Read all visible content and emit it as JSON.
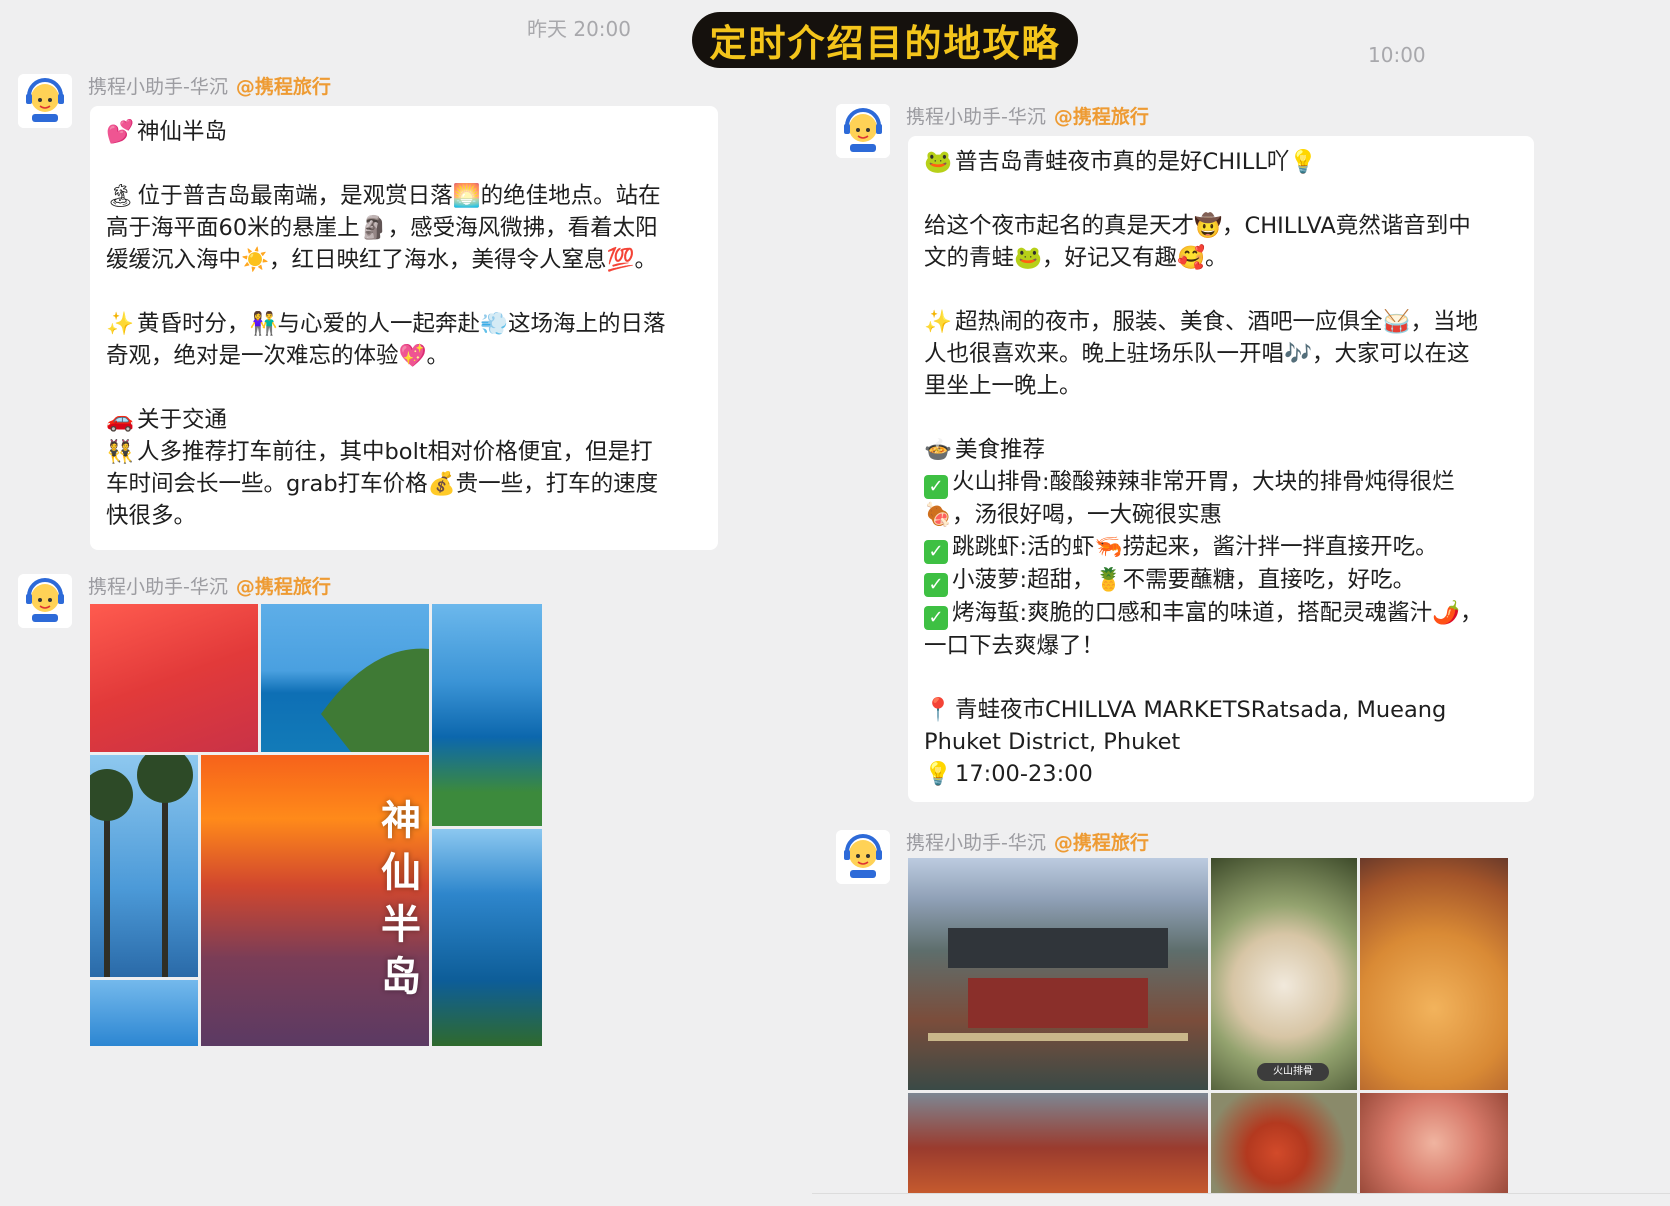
{
  "timestamps": {
    "left": "昨天 20:00",
    "right": "10:00"
  },
  "banner": {
    "text": "定时介绍目的地攻略"
  },
  "sender": {
    "name": "携程小助手-华沉",
    "tag": "@携程旅行"
  },
  "left_message": {
    "lines": [
      {
        "emoji": "💕",
        "text": "神仙半岛"
      },
      {
        "gap": true
      },
      {
        "emoji": "🏝",
        "text": "位于普吉岛最南端，是观赏日落🌅的绝佳地点。站在"
      },
      {
        "text": "高于海平面60米的悬崖上🗿，感受海风微拂，看着太阳"
      },
      {
        "text": "缓缓沉入海中☀️，红日映红了海水，美得令人窒息💯。"
      },
      {
        "gap": true
      },
      {
        "emoji": "✨",
        "text": "黄昏时分，👫与心爱的人一起奔赴💨这场海上的日落"
      },
      {
        "text": "奇观，绝对是一次难忘的体验💖。"
      },
      {
        "gap": true
      },
      {
        "emoji": "🚗",
        "text": "关于交通"
      },
      {
        "emoji": "👯",
        "text": "人多推荐打车前往，其中bolt相对价格便宜，但是打"
      },
      {
        "text": "车时间会长一些。grab打车价格💰贵一些，打车的速度"
      },
      {
        "text": "快很多。"
      }
    ]
  },
  "left_image": {
    "overlay_text": "神仙半岛"
  },
  "right_message": {
    "lines": [
      {
        "emoji": "🐸",
        "text": "普吉岛青蛙夜市真的是好CHILL吖💡"
      },
      {
        "gap": true
      },
      {
        "text": "给这个夜市起名的真是天才🤠，CHILLVA竟然谐音到中"
      },
      {
        "text": "文的青蛙🐸，好记又有趣🥰。"
      },
      {
        "gap": true
      },
      {
        "emoji": "✨",
        "text": "超热闹的夜市，服装、美食、酒吧一应俱全🥁，当地"
      },
      {
        "text": "人也很喜欢来。晚上驻场乐队一开唱🎶，大家可以在这"
      },
      {
        "text": "里坐上一晚上。"
      },
      {
        "gap": true
      },
      {
        "emoji": "🍲",
        "text": "美食推荐"
      },
      {
        "check": true,
        "text": "火山排骨:酸酸辣辣非常开胃，大块的排骨炖得很烂"
      },
      {
        "text": "🍖，汤很好喝，一大碗很实惠"
      },
      {
        "check": true,
        "text": "跳跳虾:活的虾🦐捞起来，酱汁拌一拌直接开吃。"
      },
      {
        "check": true,
        "text": "小菠萝:超甜，🍍不需要蘸糖，直接吃，好吃。"
      },
      {
        "check": true,
        "text": "烤海蜇:爽脆的口感和丰富的味道，搭配灵魂酱汁🌶️，"
      },
      {
        "text": "一口下去爽爆了！"
      },
      {
        "gap": true
      },
      {
        "emoji": "📍",
        "text": "青蛙夜市CHILLVA MARKETSRatsada, Mueang"
      },
      {
        "text": "Phuket District, Phuket"
      },
      {
        "emoji": "💡",
        "text": "17:00-23:00"
      }
    ]
  },
  "right_image": {
    "badge_text": "火山排骨"
  },
  "colors": {
    "background": "#efeff0",
    "banner_bg": "#15110d",
    "banner_text": "#f4c51b",
    "tag": "#ee9b33",
    "sender": "#9c9ca1"
  }
}
